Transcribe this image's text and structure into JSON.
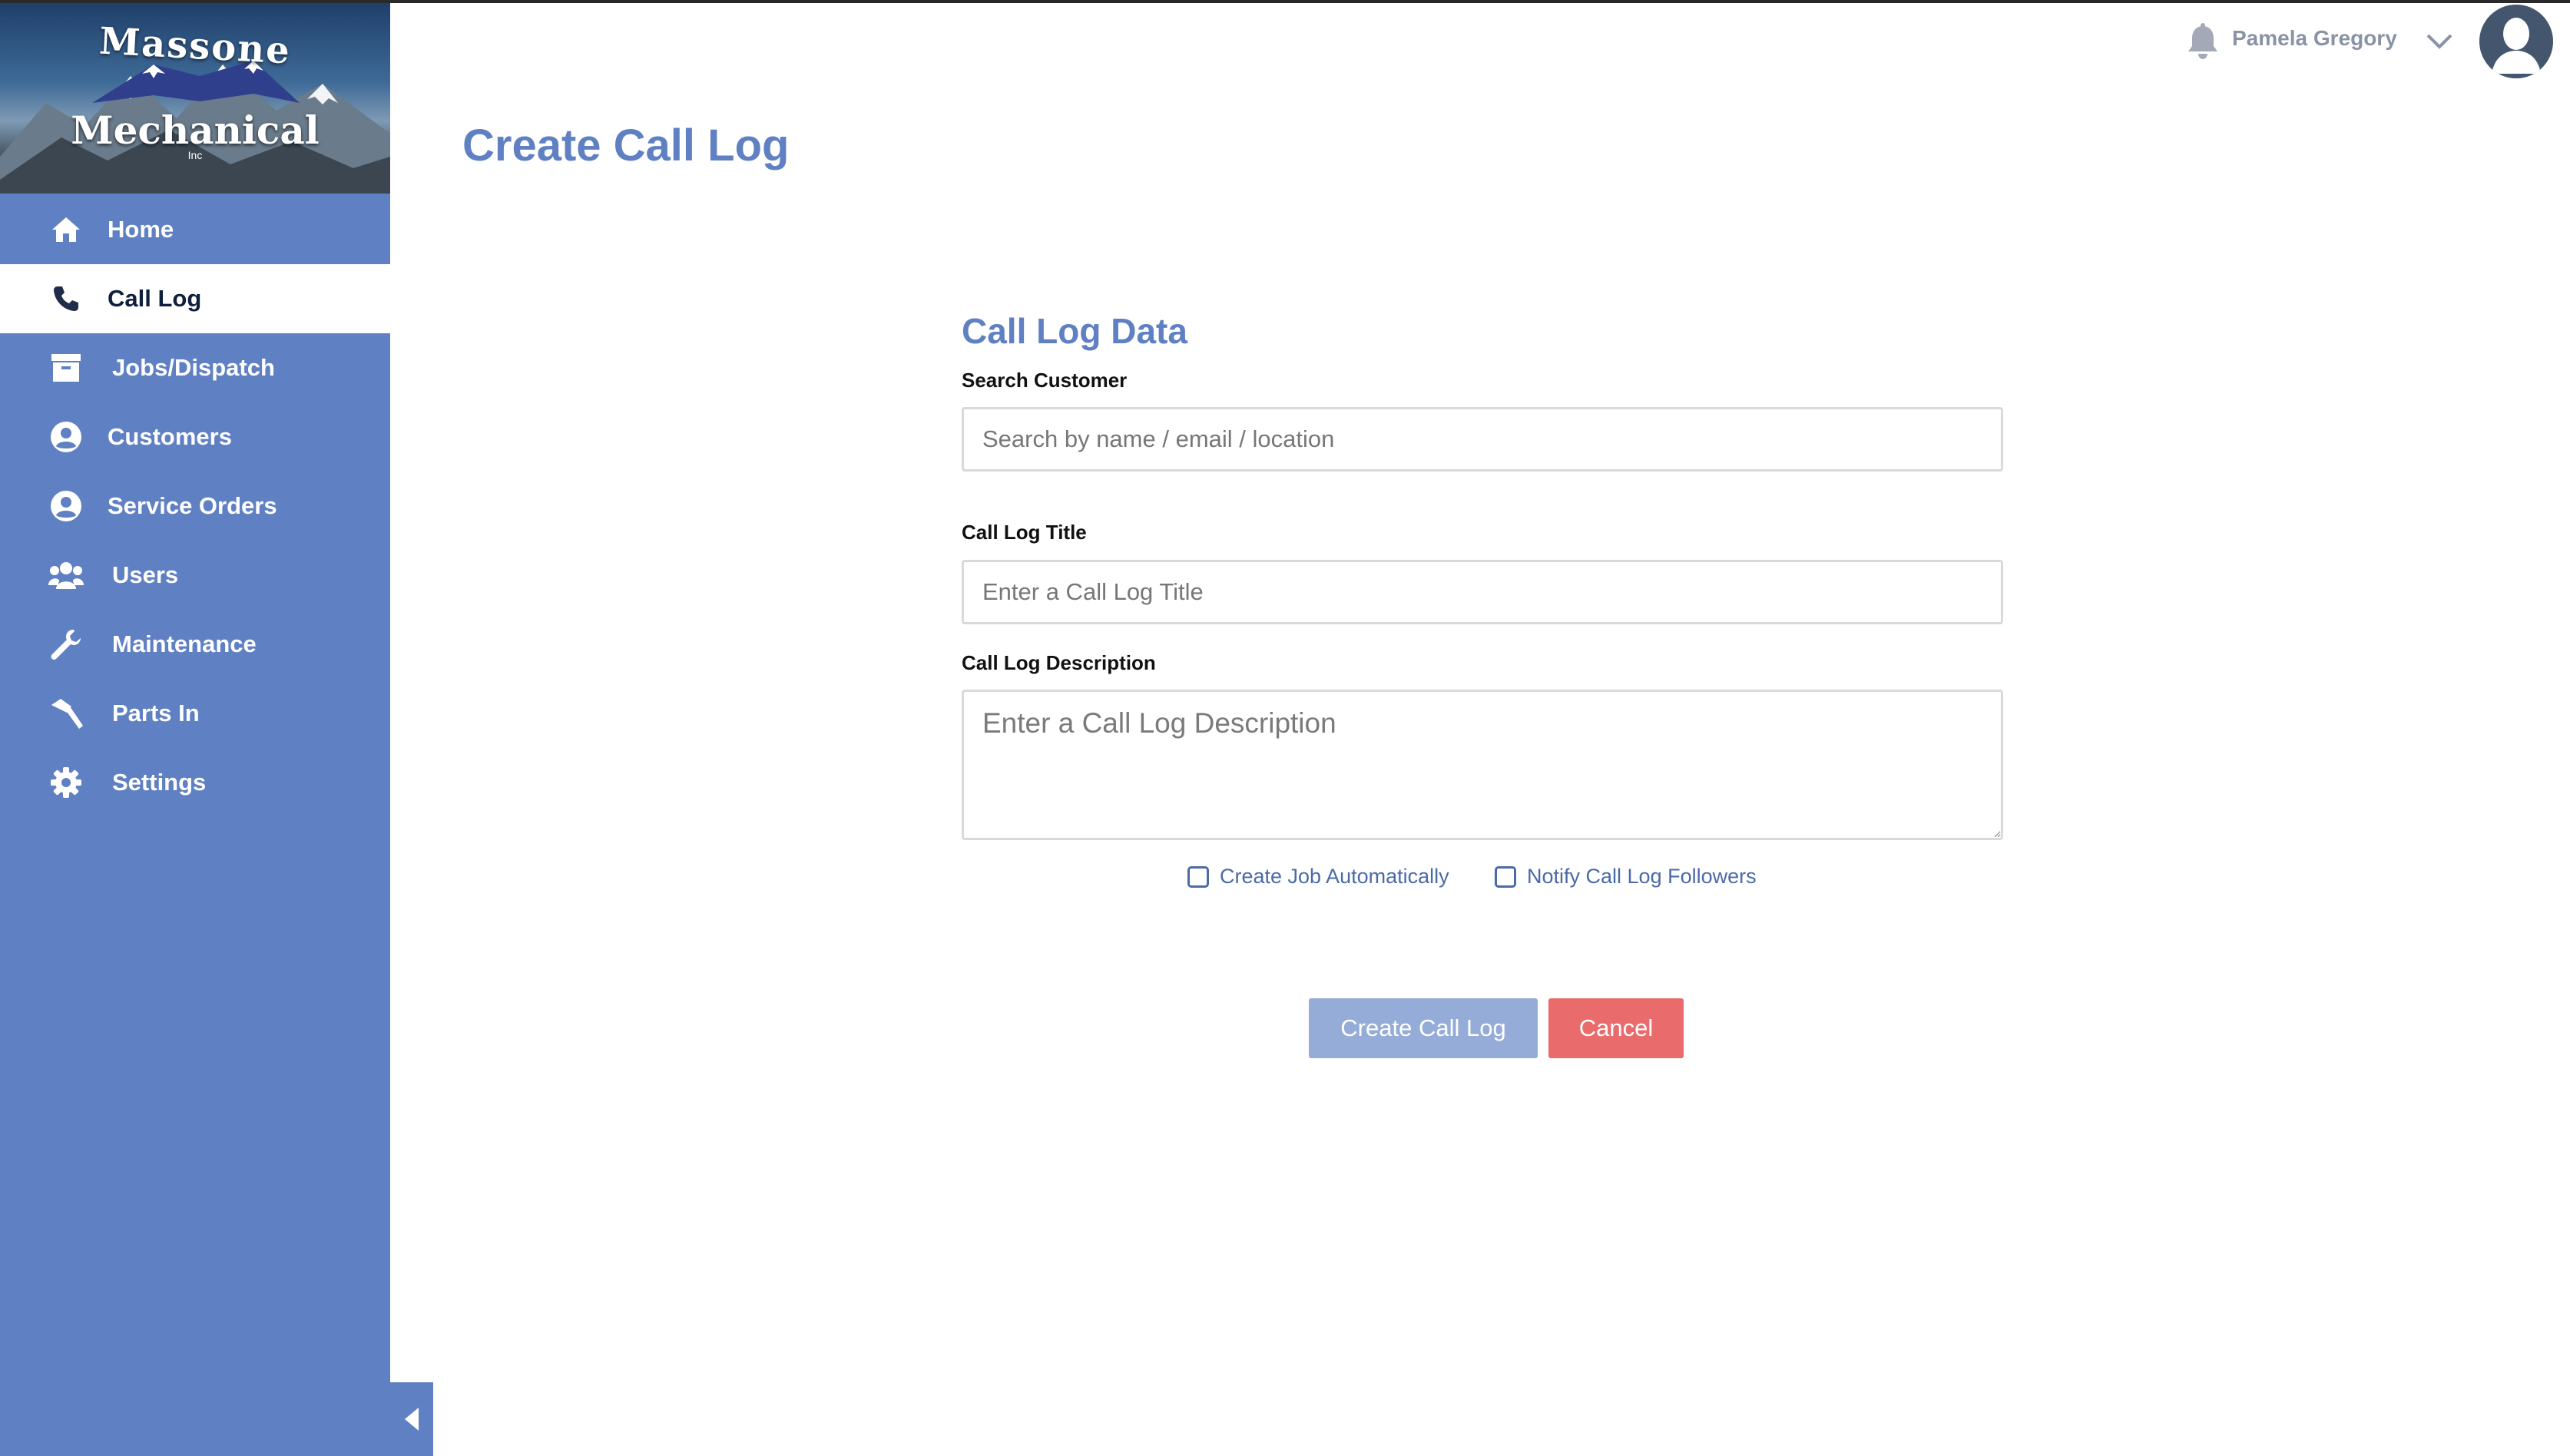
{
  "brand": {
    "line1": "Massone",
    "line2": "Mechanical",
    "line3": "Inc"
  },
  "sidebar": {
    "items": [
      {
        "label": "Home",
        "icon": "home-icon",
        "active": false
      },
      {
        "label": "Call Log",
        "icon": "phone-icon",
        "active": true
      },
      {
        "label": "Jobs/Dispatch",
        "icon": "archive-box-icon",
        "active": false
      },
      {
        "label": "Customers",
        "icon": "user-circle-icon",
        "active": false
      },
      {
        "label": "Service Orders",
        "icon": "user-circle-icon",
        "active": false
      },
      {
        "label": "Users",
        "icon": "users-icon",
        "active": false
      },
      {
        "label": "Maintenance",
        "icon": "wrench-icon",
        "active": false
      },
      {
        "label": "Parts In",
        "icon": "hammer-icon",
        "active": false
      },
      {
        "label": "Settings",
        "icon": "gear-icon",
        "active": false
      }
    ]
  },
  "header": {
    "user_name": "Pamela Gregory"
  },
  "page": {
    "title": "Create Call Log"
  },
  "form": {
    "section_title": "Call Log Data",
    "search_label": "Search Customer",
    "search_placeholder": "Search by name / email / location",
    "title_label": "Call Log Title",
    "title_placeholder": "Enter a Call Log Title",
    "description_label": "Call Log Description",
    "description_placeholder": "Enter a Call Log Description",
    "create_job_label": "Create Job Automatically",
    "notify_label": "Notify Call Log Followers",
    "create_button": "Create Call Log",
    "cancel_button": "Cancel"
  },
  "colors": {
    "sidebar": "#5f80c2",
    "accent": "#5f80c2",
    "primary_button": "#94acd7",
    "cancel_button": "#ea6b6b"
  }
}
